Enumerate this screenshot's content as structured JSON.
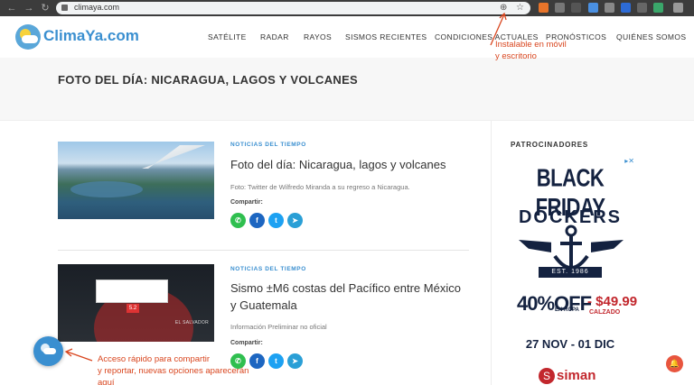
{
  "browser": {
    "back_icon": "arrow-left-icon",
    "forward_icon": "arrow-right-icon",
    "reload_icon": "reload-icon",
    "url": "climaya.com",
    "install_icon": "install-app-icon",
    "bookmark_icon": "star-icon"
  },
  "site": {
    "logo_text": "ClimaYa.com",
    "nav": [
      "SATÉLITE",
      "RADAR",
      "RAYOS",
      "SISMOS RECIENTES",
      "CONDICIONES ACTUALES",
      "PRONÓSTICOS",
      "QUIÉNES SOMOS"
    ]
  },
  "page": {
    "title": "FOTO DEL DÍA: NICARAGUA, LAGOS Y VOLCANES"
  },
  "articles": [
    {
      "category": "NOTICIAS DEL TIEMPO",
      "title": "Foto del día: Nicaragua, lagos y volcanes",
      "excerpt": "Foto: Twitter de Wilfredo Miranda a su regreso a Nicaragua.",
      "share_label": "Compartir:"
    },
    {
      "category": "NOTICIAS DEL TIEMPO",
      "title": "Sismo ±M6 costas del Pacífico entre México y Guatemala",
      "excerpt": "Información Preliminar no oficial",
      "share_label": "Compartir:",
      "map_country_label": "EL SALVADOR",
      "map_marker": "5.2"
    }
  ],
  "share_buttons": [
    {
      "name": "whatsapp",
      "glyph": "✆",
      "color": "#2fbf4f"
    },
    {
      "name": "facebook",
      "glyph": "f",
      "color": "#1d66c1"
    },
    {
      "name": "twitter",
      "glyph": "t",
      "color": "#1da1f2"
    },
    {
      "name": "telegram",
      "glyph": "➤",
      "color": "#2a9fd6"
    }
  ],
  "sidebar": {
    "title": "PATROCINADORES",
    "ad": {
      "headline": "BLACK FRIDAY",
      "brand": "DOCKERS",
      "est": "EST. 1986",
      "offer": "40%OFF",
      "offer_sub": "EN ROPA",
      "price": "- $49.99",
      "price_sub": "CALZADO",
      "dates": "27 NOV - 01 DIC",
      "store": "siman"
    }
  },
  "annotations": {
    "install": [
      "Instalable en móvil",
      "y escritorio"
    ],
    "share": [
      "Acceso rápido para compartir",
      "y reportar, nuevas opciones aparecerán",
      "aquí"
    ]
  },
  "colors": {
    "accent": "#3a8fd0",
    "annotation": "#d9461f",
    "notification": "#e8553e"
  }
}
